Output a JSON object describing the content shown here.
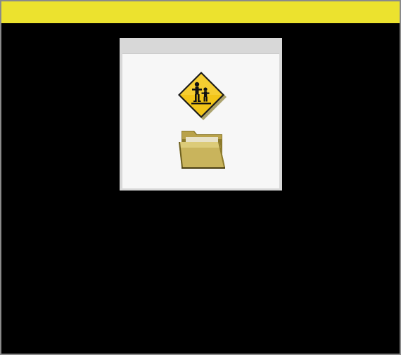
{
  "window": {
    "title_bar_color": "#ece22e",
    "background_color": "#000000"
  },
  "panel": {
    "icons": [
      {
        "name": "children-crossing-sign-icon"
      },
      {
        "name": "folder-icon"
      }
    ]
  }
}
